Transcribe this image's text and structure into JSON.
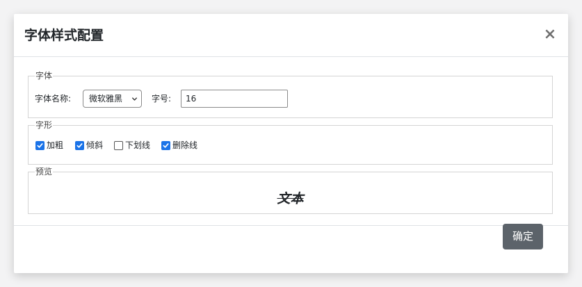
{
  "dialog": {
    "title": "字体样式配置",
    "close_glyph": "×"
  },
  "font_group": {
    "legend": "字体",
    "name_label": "字体名称:",
    "name_value": "微软雅黑",
    "size_label": "字号:",
    "size_value": "16"
  },
  "style_group": {
    "legend": "字形",
    "options": [
      {
        "label": "加粗",
        "checked": true
      },
      {
        "label": "倾斜",
        "checked": true
      },
      {
        "label": "下划线",
        "checked": false
      },
      {
        "label": "删除线",
        "checked": true
      }
    ]
  },
  "preview_group": {
    "legend": "预览",
    "sample_text": "文本"
  },
  "footer": {
    "confirm_label": "确定"
  },
  "colors": {
    "accent_checkbox": "#1a73e8",
    "confirm_button": "#5c636a"
  },
  "icons": {
    "close": "close-icon",
    "select_arrow": "chevron-down-icon",
    "check": "checkmark-icon"
  }
}
